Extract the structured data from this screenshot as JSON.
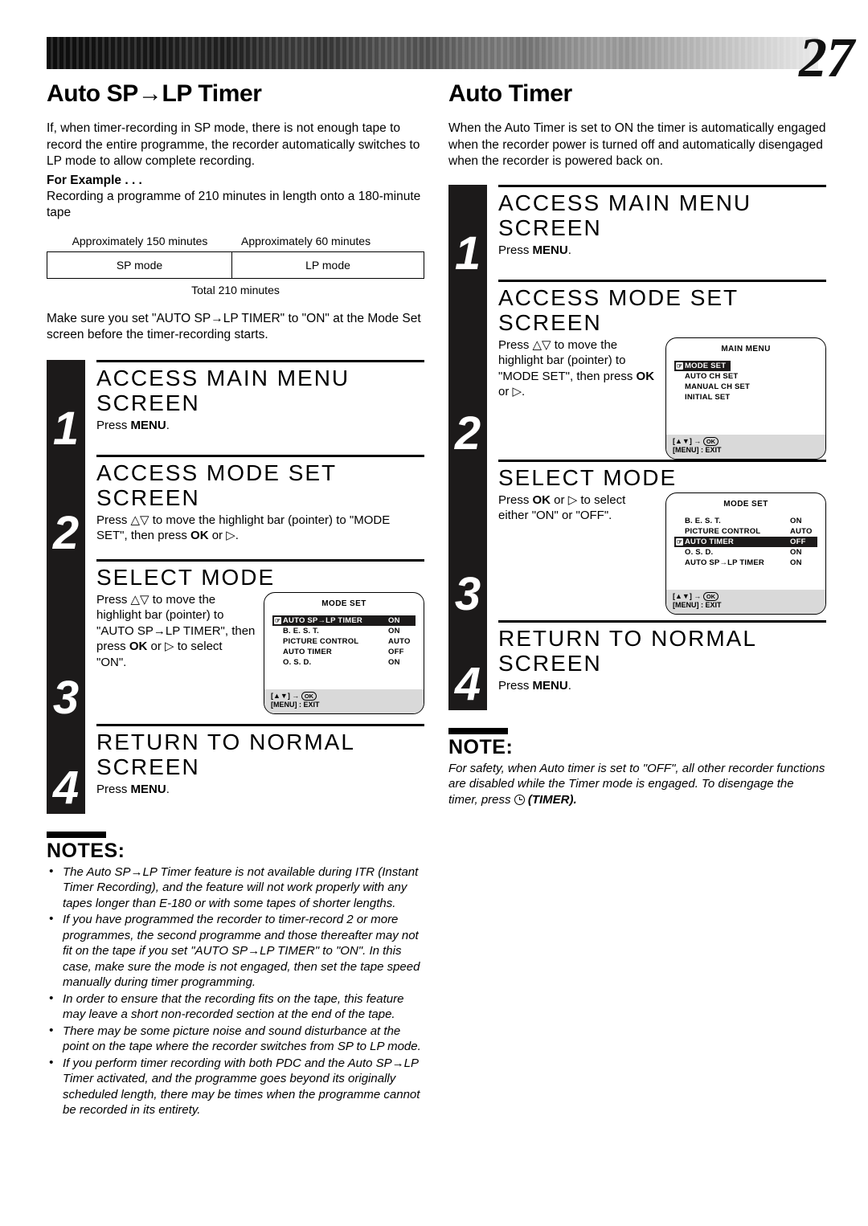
{
  "page": {
    "number": "27"
  },
  "left": {
    "title": "Auto SP→LP Timer",
    "intro": "If, when timer-recording in SP mode, there is not enough tape to record the entire programme, the recorder automatically switches to LP mode to allow complete recording.",
    "for_example_label": "For Example . . .",
    "example_text": "Recording a programme of 210 minutes in length onto a 180-minute tape",
    "table": {
      "label_sp": "Approximately 150 minutes",
      "label_lp": "Approximately 60 minutes",
      "cell_sp": "SP mode",
      "cell_lp": "LP mode",
      "total": "Total 210 minutes"
    },
    "after_table": "Make sure you set \"AUTO SP→LP TIMER\" to \"ON\" at the Mode Set screen before the timer-recording starts.",
    "steps": [
      {
        "num": "1",
        "head": "ACCESS MAIN MENU SCREEN",
        "text_pre": "Press ",
        "text_bold": "MENU",
        "text_post": "."
      },
      {
        "num": "2",
        "head": "ACCESS MODE SET SCREEN",
        "text_pre": "Press △▽ to move the highlight bar (pointer) to \"MODE SET\", then press ",
        "text_bold": "OK",
        "text_post": " or ▷."
      },
      {
        "num": "3",
        "head": "SELECT MODE",
        "text_pre": "Press △▽ to move the highlight bar (pointer) to \"AUTO SP→LP TIMER\", then press ",
        "text_bold": "OK",
        "text_post": " or ▷ to select \"ON\"."
      },
      {
        "num": "4",
        "head": "RETURN TO NORMAL SCREEN",
        "text_pre": "Press ",
        "text_bold": "MENU",
        "text_post": "."
      }
    ],
    "osd_mode_set": {
      "title": "MODE SET",
      "rows": [
        {
          "name": "B. E. S. T.",
          "value": "ON",
          "highlighted": false
        },
        {
          "name": "PICTURE CONTROL",
          "value": "AUTO",
          "highlighted": false
        },
        {
          "name": "AUTO TIMER",
          "value": "OFF",
          "highlighted": false
        },
        {
          "name": "O. S. D.",
          "value": "ON",
          "highlighted": false
        },
        {
          "name": "AUTO SP→LP TIMER",
          "value": "ON",
          "highlighted": true
        }
      ],
      "foot_line1_pre": "[▲▼] → ",
      "foot_ok": "OK",
      "foot_line2": "[MENU] : EXIT"
    },
    "notes_title": "NOTES:",
    "notes": [
      "The Auto SP→LP Timer feature is not available during ITR (Instant Timer Recording), and the feature will not work properly with any tapes longer than E-180 or with some tapes of shorter lengths.",
      "If you have programmed the recorder to timer-record 2 or more programmes, the second programme and those thereafter may not fit on the tape if you set \"AUTO SP→LP TIMER\" to \"ON\". In this case, make sure the mode is not engaged, then set the tape speed manually during timer programming.",
      "In order to ensure that the recording fits on the tape, this feature may leave a short non-recorded section at the end of the tape.",
      "There may be some picture noise and sound disturbance at the point on the tape where the recorder switches from SP to LP mode.",
      "If you perform timer recording with both PDC and the Auto SP→LP Timer activated, and the programme goes beyond its originally scheduled length, there may be times when the programme cannot be recorded in its entirety."
    ]
  },
  "right": {
    "title": "Auto Timer",
    "intro": "When the Auto Timer is set to ON the timer is automatically engaged when the recorder power is turned off and automatically disengaged when the recorder is powered back on.",
    "steps": [
      {
        "num": "1",
        "head": "ACCESS MAIN MENU SCREEN",
        "text_pre": "Press ",
        "text_bold": "MENU",
        "text_post": "."
      },
      {
        "num": "2",
        "head": "ACCESS MODE SET SCREEN",
        "text_pre": "Press △▽ to move the highlight bar (pointer) to \"MODE SET\", then press ",
        "text_bold": "OK",
        "text_post": " or ▷."
      },
      {
        "num": "3",
        "head": "SELECT MODE",
        "text_pre": "Press ",
        "text_bold": "OK",
        "text_post": " or ▷ to select either \"ON\" or \"OFF\"."
      },
      {
        "num": "4",
        "head": "RETURN TO NORMAL SCREEN",
        "text_pre": "Press ",
        "text_bold": "MENU",
        "text_post": "."
      }
    ],
    "osd_main_menu": {
      "title": "MAIN MENU",
      "rows": [
        {
          "name": "MODE SET",
          "value": "",
          "highlighted": true
        },
        {
          "name": "AUTO CH SET",
          "value": "",
          "highlighted": false
        },
        {
          "name": "MANUAL CH SET",
          "value": "",
          "highlighted": false
        },
        {
          "name": "INITIAL SET",
          "value": "",
          "highlighted": false
        }
      ],
      "foot_line1_pre": "[▲▼] → ",
      "foot_ok": "OK",
      "foot_line2": "[MENU] : EXIT"
    },
    "osd_mode_set": {
      "title": "MODE SET",
      "rows": [
        {
          "name": "B. E. S. T.",
          "value": "ON",
          "highlighted": false
        },
        {
          "name": "PICTURE CONTROL",
          "value": "AUTO",
          "highlighted": false
        },
        {
          "name": "AUTO TIMER",
          "value": "OFF",
          "highlighted": true
        },
        {
          "name": "O. S. D.",
          "value": "ON",
          "highlighted": false
        },
        {
          "name": "AUTO SP→LP TIMER",
          "value": "ON",
          "highlighted": false
        }
      ],
      "foot_line1_pre": "[▲▼] → ",
      "foot_ok": "OK",
      "foot_line2": "[MENU] : EXIT"
    },
    "note_title": "NOTE:",
    "note_text_pre": "For safety, when Auto timer is set to \"OFF\", all other recorder functions are disabled while the Timer mode is engaged. To disengage the timer, press ",
    "note_icon": "clock-icon",
    "note_text_post": "(TIMER)."
  }
}
